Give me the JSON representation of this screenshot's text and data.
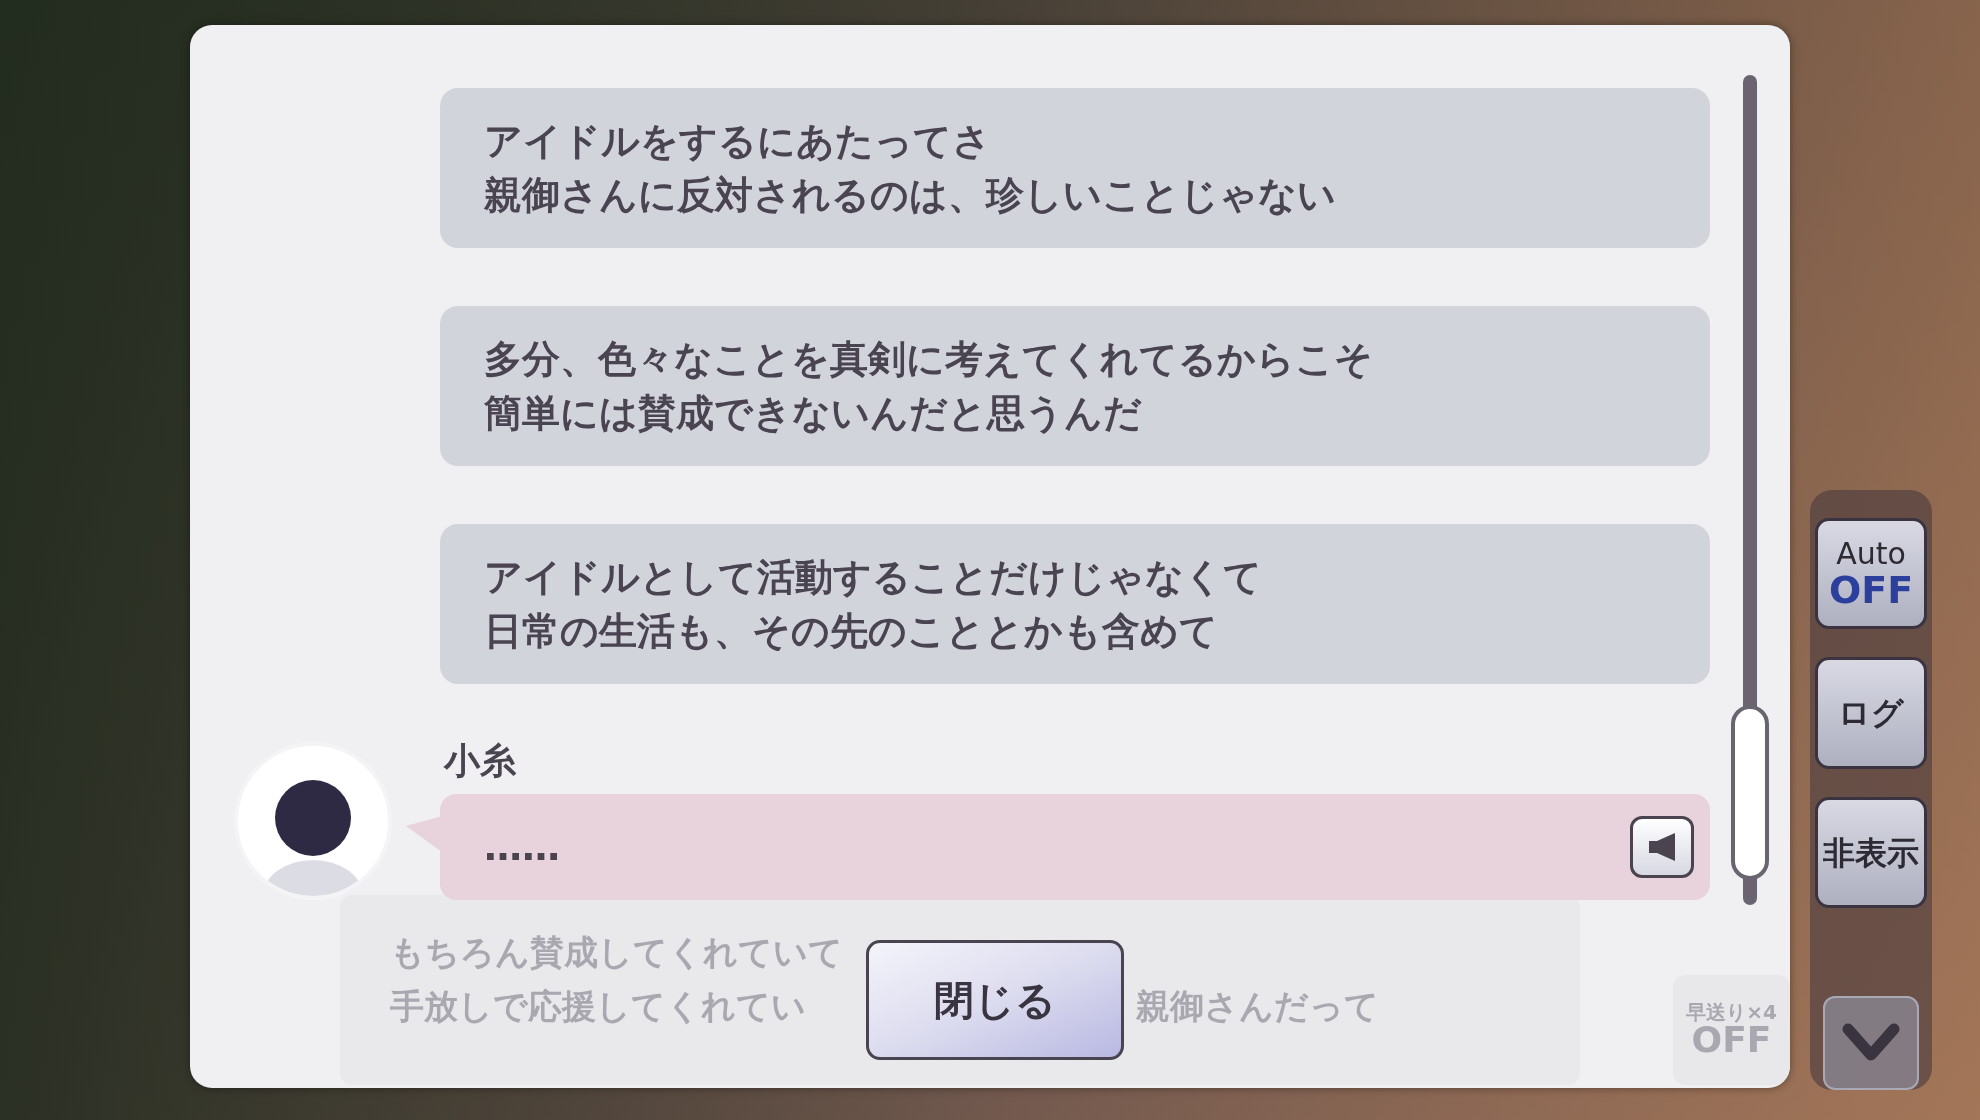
{
  "log_entries": [
    {
      "kind": "narration",
      "lines": [
        "アイドルをするにあたってさ",
        "親御さんに反対されるのは、珍しいことじゃない"
      ]
    },
    {
      "kind": "narration",
      "lines": [
        "多分、色々なことを真剣に考えてくれてるからこそ",
        "簡単には賛成できないんだと思うんだ"
      ]
    },
    {
      "kind": "narration",
      "lines": [
        "アイドルとして活動することだけじゃなくて",
        "日常の生活も、その先のこととかも含めて"
      ]
    },
    {
      "kind": "dialogue",
      "speaker": "小糸",
      "lines": [
        "……"
      ]
    }
  ],
  "background_message": {
    "lines": [
      [
        "もちろん賛成してくれていて"
      ],
      [
        "手放しで応援してくれてい",
        "親御さんだって"
      ]
    ]
  },
  "fast_forward": {
    "label": "早送り×4",
    "state": "OFF"
  },
  "close_button": "閉じる",
  "side_buttons": [
    {
      "kind": "auto",
      "label": "Auto",
      "state": "OFF"
    },
    {
      "kind": "text",
      "label": "ログ"
    },
    {
      "kind": "text",
      "label": "非表示"
    },
    {
      "kind": "chevron"
    }
  ]
}
